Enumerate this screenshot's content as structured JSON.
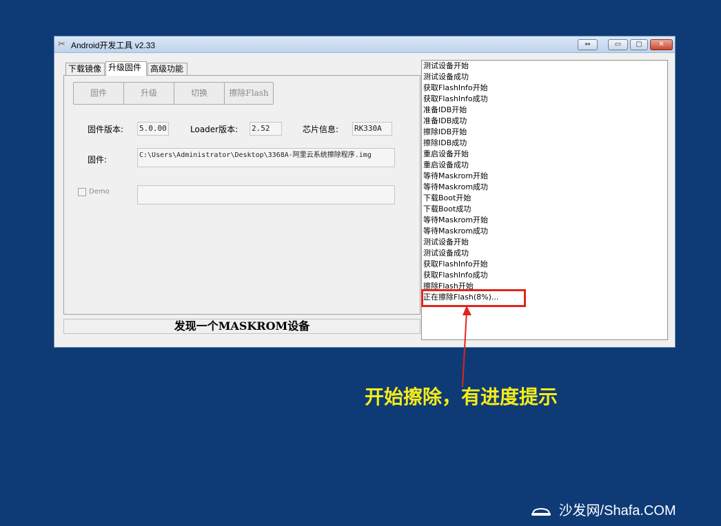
{
  "window": {
    "title": "Android开发工具 v2.33",
    "controls": {
      "restore": "⇔",
      "minimize": "▭",
      "maximize": "▢",
      "close": "✕"
    }
  },
  "tabs": [
    "下载镜像",
    "升级固件",
    "高级功能"
  ],
  "actions": {
    "firmware": "固件",
    "upgrade": "升级",
    "switch": "切换",
    "erase_flash": "擦除Flash"
  },
  "info": {
    "firmware_version_label": "固件版本:",
    "firmware_version": "5.0.00",
    "loader_version_label": "Loader版本:",
    "loader_version": "2.52",
    "chip_info_label": "芯片信息:",
    "chip_info": "RK330A",
    "firmware_label": "固件:",
    "firmware_path": "C:\\Users\\Administrator\\Desktop\\3368A-阿里云系统擦除程序.img",
    "demo_label": "Demo",
    "demo_value": ""
  },
  "status": "发现一个MASKROM设备",
  "log": [
    "测试设备开始",
    "测试设备成功",
    "获取FlashInfo开始",
    "获取FlashInfo成功",
    "准备IDB开始",
    "准备IDB成功",
    "擦除IDB开始",
    "擦除IDB成功",
    "重启设备开始",
    "重启设备成功",
    "等待Maskrom开始",
    "等待Maskrom成功",
    "下载Boot开始",
    "下载Boot成功",
    "等待Maskrom开始",
    "等待Maskrom成功",
    "测试设备开始",
    "测试设备成功",
    "获取FlashInfo开始",
    "获取FlashInfo成功",
    "擦除Flash开始",
    "正在擦除Flash(8%)..."
  ],
  "annotation": "开始擦除，有进度提示",
  "watermark": "沙发网/Shafa.COM",
  "colors": {
    "background": "#0e3b76",
    "highlight": "#e2231a",
    "annotation": "#f7ec18"
  }
}
